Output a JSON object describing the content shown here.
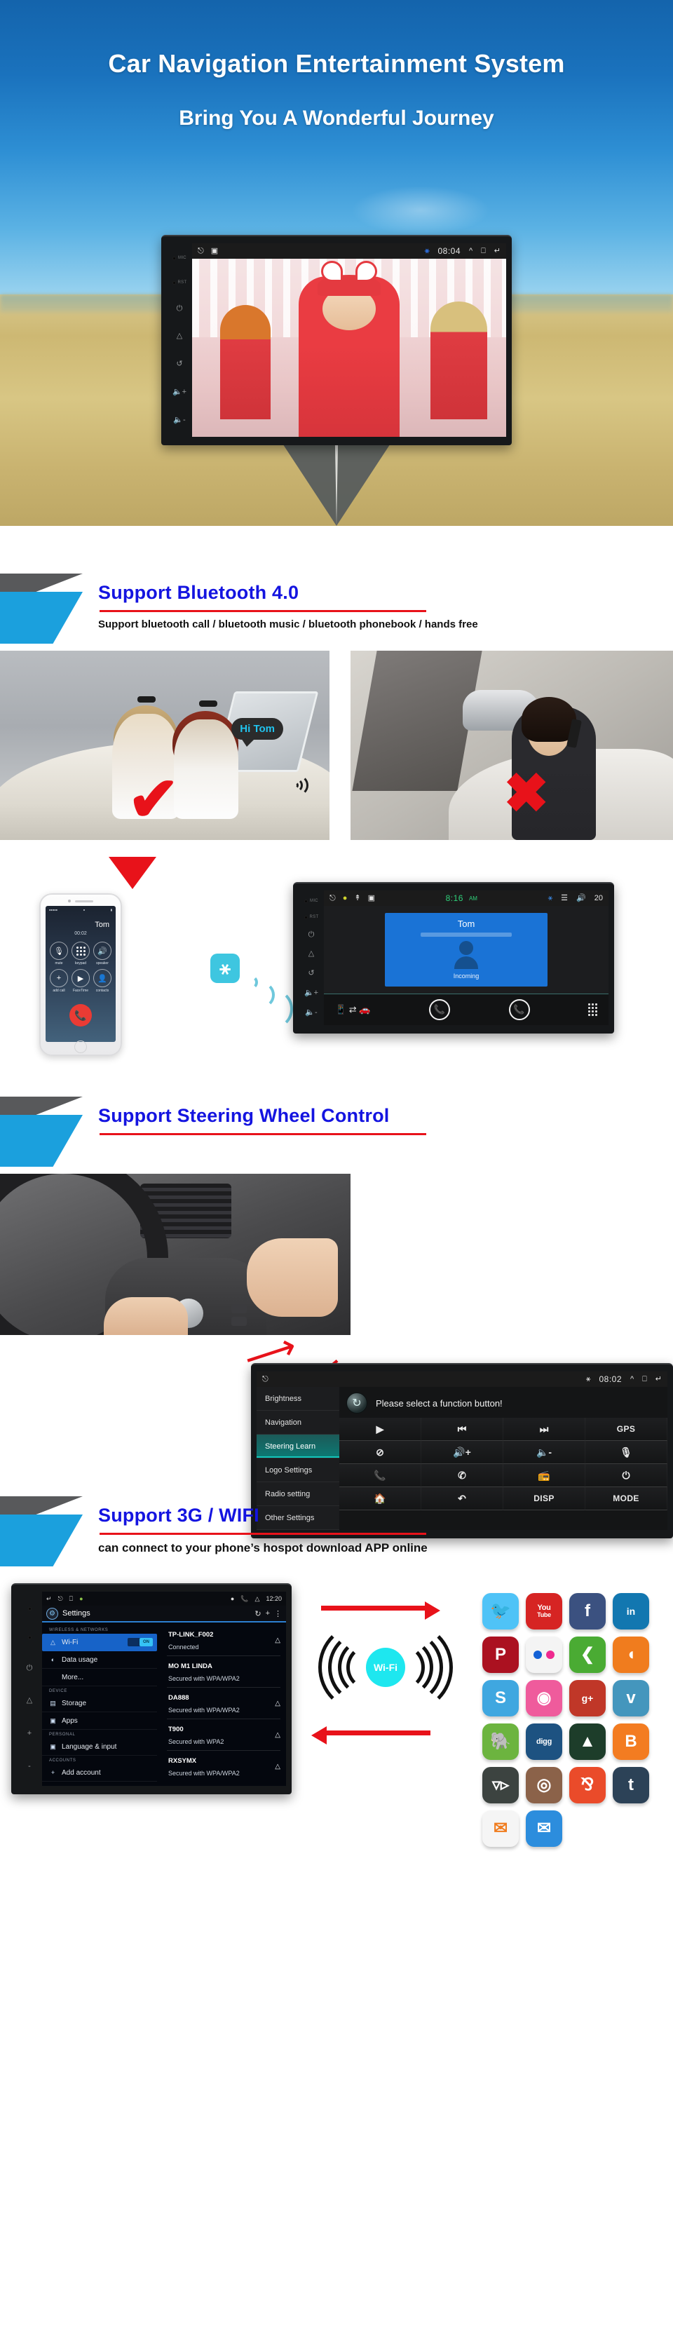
{
  "hero": {
    "title": "Car Navigation Entertainment System",
    "subtitle": "Bring You A Wonderful Journey",
    "unit": {
      "labels": {
        "mic": "MIC",
        "rst": "RST"
      },
      "status_time": "08:04",
      "icons": [
        "home-icon",
        "recents-icon",
        "bluetooth-icon",
        "expand-icon",
        "window-icon",
        "back-icon"
      ]
    }
  },
  "sections": {
    "bluetooth": {
      "title": "Support Bluetooth 4.0",
      "subtitle": "Support bluetooth call / bluetooth music / bluetooth phonebook / hands free",
      "photo_left_bubble": "Hi Tom",
      "mark_good": "✔",
      "mark_bad": "✖",
      "phone": {
        "contact": "Tom",
        "duration": "00:02",
        "buttons": [
          {
            "label": "mute",
            "icon": "mute-mic-icon",
            "glyph": "Ἲ4"
          },
          {
            "label": "keypad",
            "icon": "keypad-icon",
            "glyph": ""
          },
          {
            "label": "speaker",
            "icon": "speaker-icon",
            "glyph": "ὐA"
          },
          {
            "label": "add call",
            "icon": "add-call-icon",
            "glyph": "+"
          },
          {
            "label": "FaceTime",
            "icon": "facetime-icon",
            "glyph": "▶"
          },
          {
            "label": "contacts",
            "icon": "contacts-icon",
            "glyph": "὆4"
          }
        ],
        "end_call_icon": "end-call-icon"
      },
      "bt_badge_icon": "bluetooth-icon",
      "car_unit": {
        "status_time": "8:16",
        "status_ampm": "AM",
        "volume": "20",
        "caller": "Tom",
        "call_state": "Incoming",
        "bottom_icons": [
          "phone-to-car-icon",
          "answer-call-icon",
          "hangup-call-icon",
          "keypad-icon"
        ]
      }
    },
    "steering": {
      "title": "Support Steering Wheel Control",
      "panel": {
        "status_time": "08:02",
        "prompt": "Please select a function button!",
        "refresh_icon": "refresh-icon",
        "menu": [
          {
            "label": "Brightness",
            "active": false
          },
          {
            "label": "Navigation",
            "active": false
          },
          {
            "label": "Steering Learn",
            "active": true
          },
          {
            "label": "Logo Settings",
            "active": false
          },
          {
            "label": "Radio setting",
            "active": false
          },
          {
            "label": "Other Settings",
            "active": false
          }
        ],
        "buttons": [
          {
            "icon": "play-icon",
            "glyph": "▶",
            "text": false
          },
          {
            "icon": "previous-track-icon",
            "glyph": "⏮",
            "text": false
          },
          {
            "icon": "next-track-icon",
            "glyph": "⏭",
            "text": false
          },
          {
            "icon": "gps-icon",
            "glyph": "GPS",
            "text": true
          },
          {
            "icon": "mute-icon",
            "glyph": "ὐ7",
            "text": false
          },
          {
            "icon": "volume-up-icon",
            "glyph": "ὐA+",
            "text": false
          },
          {
            "icon": "volume-down-icon",
            "glyph": "ὐ9-",
            "text": false
          },
          {
            "icon": "microphone-icon",
            "glyph": "Ἲ4",
            "text": false
          },
          {
            "icon": "call-icon",
            "glyph": "ὍE",
            "text": false
          },
          {
            "icon": "hangup-icon",
            "glyph": "✆",
            "text": false
          },
          {
            "icon": "radio-icon",
            "glyph": "὏B",
            "text": false
          },
          {
            "icon": "power-icon",
            "glyph": "⏻",
            "text": false
          },
          {
            "icon": "home-icon",
            "glyph": "Ἶ0",
            "text": false
          },
          {
            "icon": "back-icon",
            "glyph": "↶",
            "text": false
          },
          {
            "icon": "disp-icon",
            "glyph": "DISP",
            "text": true
          },
          {
            "icon": "mode-icon",
            "glyph": "MODE",
            "text": true
          }
        ]
      }
    },
    "wifi": {
      "title": "Support 3G / WIFI",
      "subtitle": "can connect to your phone’s hospot download APP online",
      "wifi_label": "Wi-Fi",
      "settings": {
        "app_title": "Settings",
        "status_time": "12:20",
        "status_icons": [
          "location-icon",
          "phone-icon",
          "wifi-icon"
        ],
        "nav_icons": [
          "back-icon",
          "home-icon",
          "recents-icon",
          "android-icon"
        ],
        "action_icons": [
          "refresh-icon",
          "add-icon",
          "menu-icon"
        ],
        "sidebar": [
          {
            "type": "group",
            "label": "WIRELESS & NETWORKS"
          },
          {
            "type": "item",
            "label": "Wi-Fi",
            "icon": "wifi-icon",
            "selected": true,
            "toggle": "ON"
          },
          {
            "type": "item",
            "label": "Data usage",
            "icon": "data-usage-icon",
            "selected": false
          },
          {
            "type": "item",
            "label": "More...",
            "icon": "",
            "selected": false
          },
          {
            "type": "group",
            "label": "DEVICE"
          },
          {
            "type": "item",
            "label": "Storage",
            "icon": "storage-icon",
            "selected": false
          },
          {
            "type": "item",
            "label": "Apps",
            "icon": "apps-icon",
            "selected": false
          },
          {
            "type": "group",
            "label": "PERSONAL"
          },
          {
            "type": "item",
            "label": "Language & input",
            "icon": "language-icon",
            "selected": false
          },
          {
            "type": "group",
            "label": "ACCOUNTS"
          },
          {
            "type": "item",
            "label": "Add account",
            "icon": "add-icon",
            "selected": false
          }
        ],
        "networks": [
          {
            "ssid": "TP-LINK_F002",
            "status": "Connected",
            "signal": true
          },
          {
            "ssid": "MO M1 LINDA",
            "status": "Secured with WPA/WPA2",
            "signal": false
          },
          {
            "ssid": "DA888",
            "status": "Secured with WPA/WPA2",
            "signal": true
          },
          {
            "ssid": "T900",
            "status": "Secured with WPA2",
            "signal": true
          },
          {
            "ssid": "RXSYMX",
            "status": "Secured with WPA/WPA2",
            "signal": true
          }
        ]
      },
      "apps": [
        {
          "name": "twitter",
          "glyph": "ὂ6",
          "color": "#4fc3f7",
          "size": "normal"
        },
        {
          "name": "youtube",
          "glyph": "You",
          "color": "#d62423",
          "size": "tiny"
        },
        {
          "name": "facebook",
          "glyph": "f",
          "color": "#3b5180",
          "size": "normal"
        },
        {
          "name": "linkedin",
          "glyph": "in",
          "color": "#1277b0",
          "size": "small"
        },
        {
          "name": "pinterest",
          "glyph": "P",
          "color": "#ab1120",
          "size": "normal"
        },
        {
          "name": "flickr",
          "glyph": "",
          "color": "#f4f4f4",
          "size": "normal"
        },
        {
          "name": "share",
          "glyph": "≪",
          "color": "#4aab33",
          "size": "normal"
        },
        {
          "name": "rss",
          "glyph": "὎1",
          "color": "#f07c1e",
          "size": "normal"
        },
        {
          "name": "skype",
          "glyph": "S",
          "color": "#3fa7e0",
          "size": "normal"
        },
        {
          "name": "dribbble",
          "glyph": "●",
          "color": "#ef5b9c",
          "size": "normal"
        },
        {
          "name": "google-plus",
          "glyph": "g+",
          "color": "#c03728",
          "size": "small"
        },
        {
          "name": "vimeo",
          "glyph": "v",
          "color": "#4496bd",
          "size": "normal"
        },
        {
          "name": "evernote",
          "glyph": "ὁ8",
          "color": "#6cb43f",
          "size": "normal"
        },
        {
          "name": "digg",
          "glyph": "digg",
          "color": "#1d5281",
          "size": "tiny"
        },
        {
          "name": "forrst",
          "glyph": "▲",
          "color": "#1d3d2a",
          "size": "normal"
        },
        {
          "name": "blogger",
          "glyph": "B",
          "color": "#f37c21",
          "size": "normal"
        },
        {
          "name": "deviantart",
          "glyph": "Ὂ0",
          "color": "#3c4340",
          "size": "normal"
        },
        {
          "name": "instagram",
          "glyph": "◎",
          "color": "#8b6249",
          "size": "normal"
        },
        {
          "name": "stumbleupon",
          "glyph": "ᴑ",
          "color": "#ea4b2a",
          "size": "normal"
        },
        {
          "name": "tumblr",
          "glyph": "t",
          "color": "#2c4257",
          "size": "normal"
        },
        {
          "name": "email-light",
          "glyph": "✉",
          "color": "#f5f5f5",
          "size": "normal"
        },
        {
          "name": "email-blue",
          "glyph": "✉",
          "color": "#2c8ddd",
          "size": "normal"
        }
      ]
    }
  }
}
